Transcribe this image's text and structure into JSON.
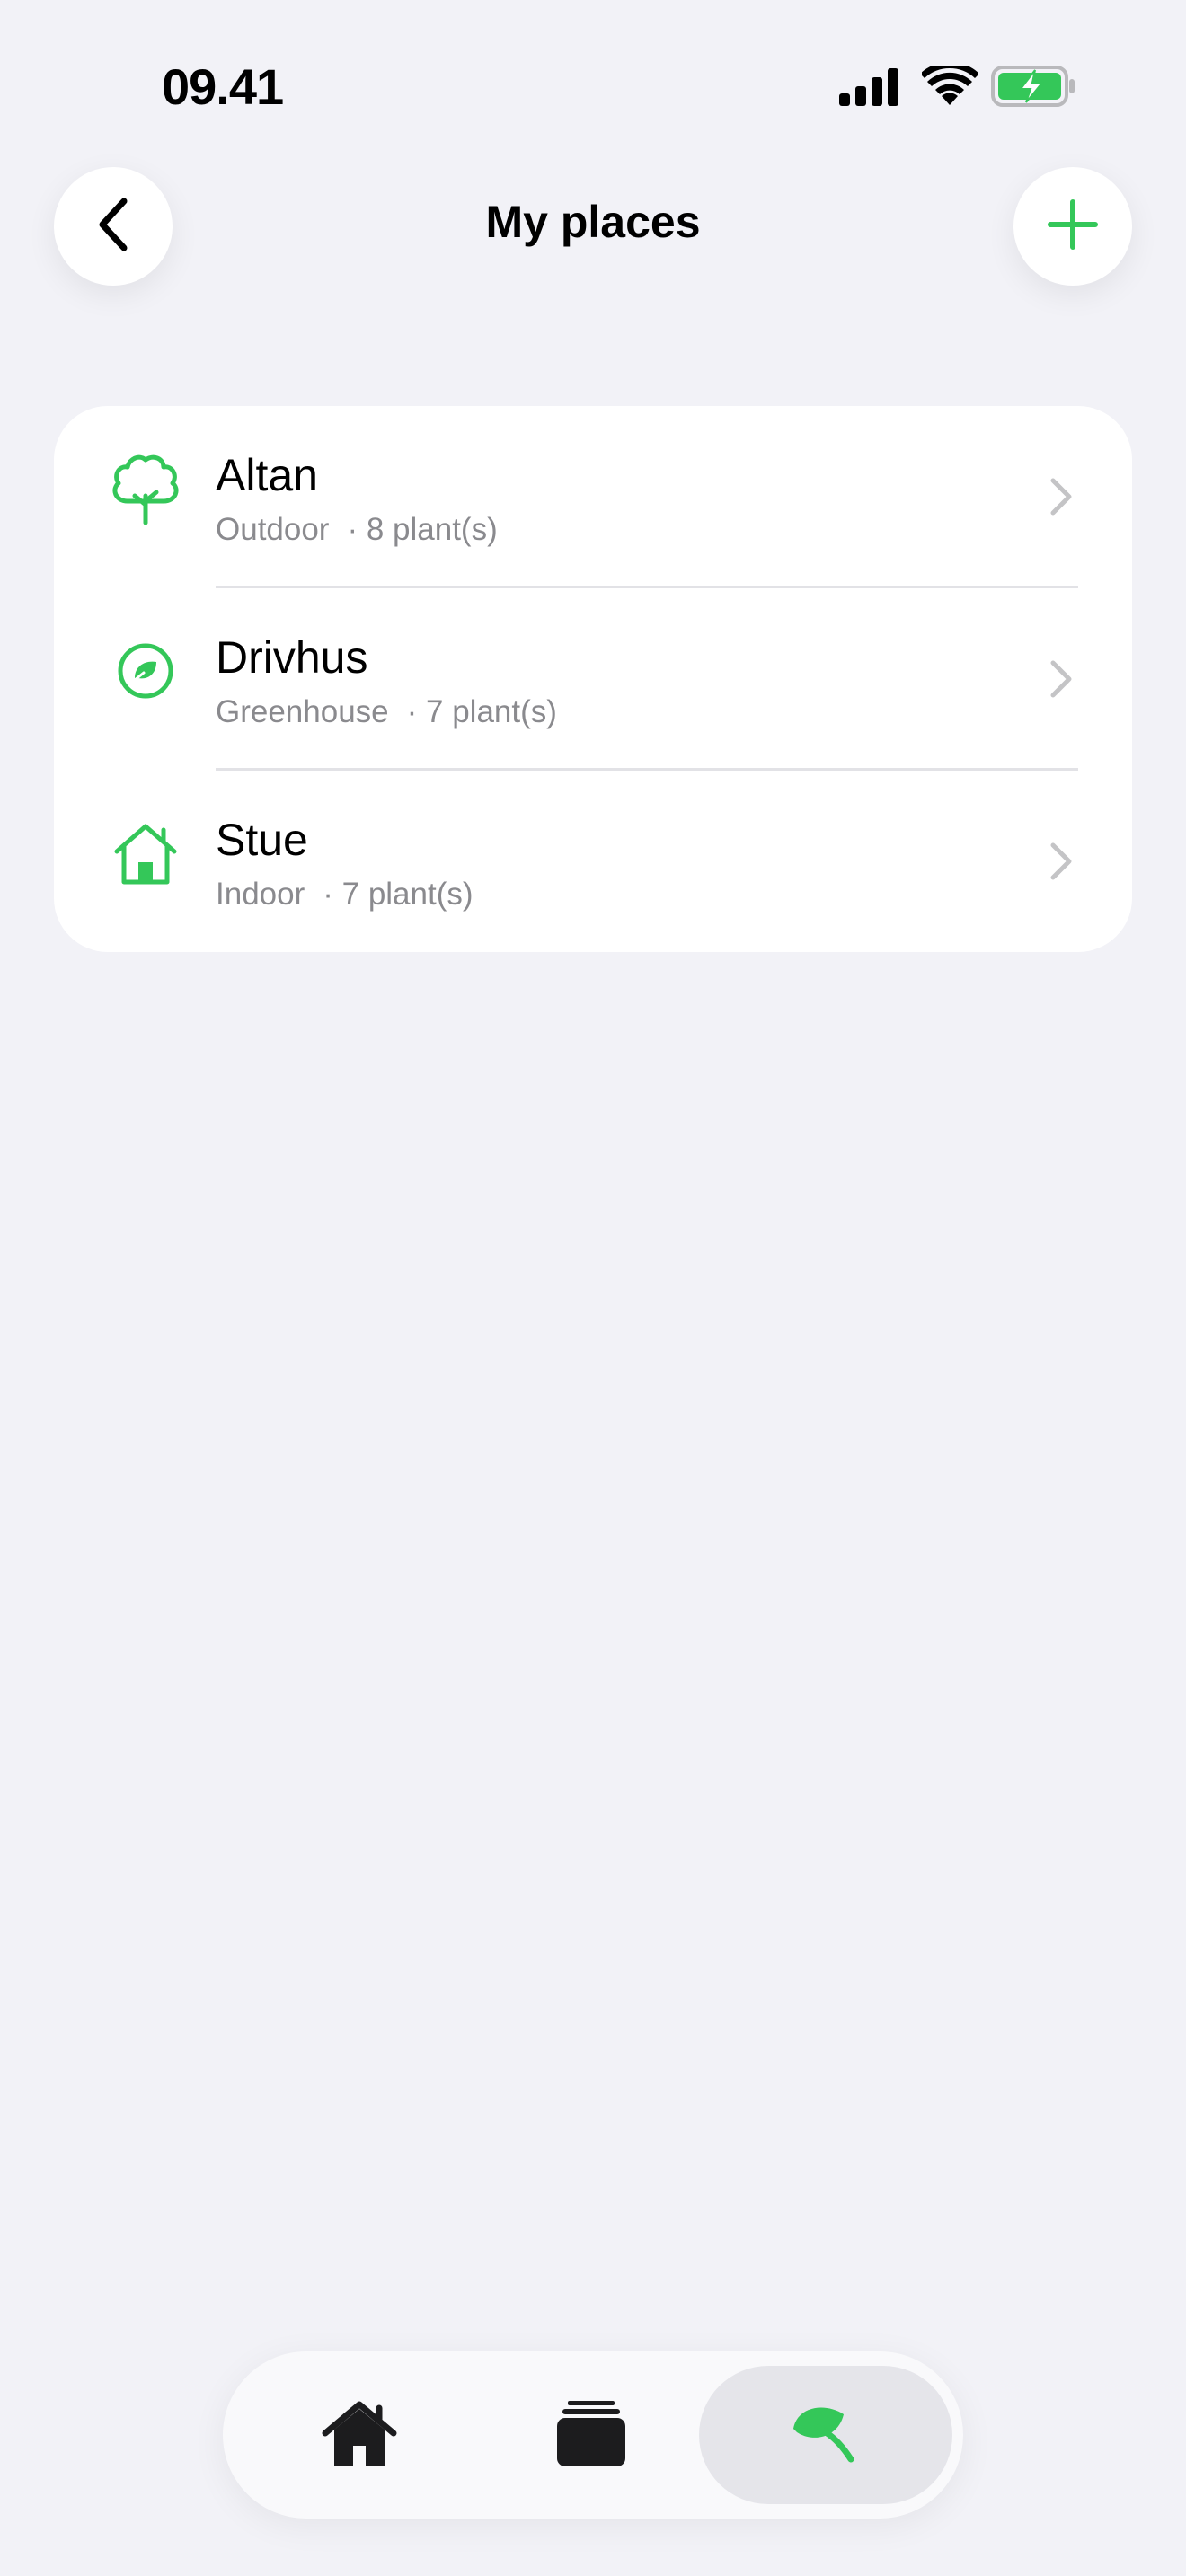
{
  "status_bar": {
    "time": "09.41",
    "icons": [
      "cellular-signal-icon",
      "wifi-icon",
      "battery-charging-icon"
    ]
  },
  "header": {
    "title": "My places",
    "back_icon": "chevron-left-icon",
    "add_icon": "plus-icon"
  },
  "places": [
    {
      "name": "Altan",
      "type": "Outdoor",
      "count": "· 8 plant(s)",
      "icon": "tree-icon"
    },
    {
      "name": "Drivhus",
      "type": "Greenhouse",
      "count": "· 7 plant(s)",
      "icon": "greenhouse-leaf-icon"
    },
    {
      "name": "Stue",
      "type": "Indoor",
      "count": "· 7 plant(s)",
      "icon": "house-icon"
    }
  ],
  "tab_bar": {
    "tabs": [
      {
        "icon": "home-icon",
        "selected": false
      },
      {
        "icon": "cards-stack-icon",
        "selected": false
      },
      {
        "icon": "leaf-icon",
        "selected": true
      }
    ]
  },
  "colors": {
    "accent": "#34c759",
    "background": "#f2f2f7",
    "card": "#ffffff",
    "secondary_text": "#8a8a8e",
    "chevron": "#c4c4c6",
    "selected_tab": "#e5e5ea"
  }
}
